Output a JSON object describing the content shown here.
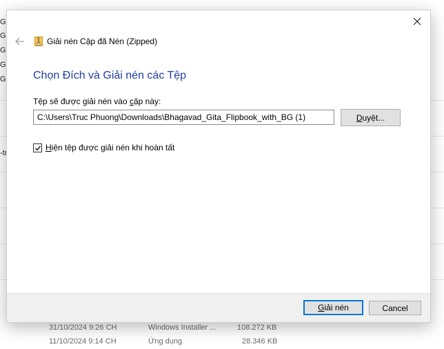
{
  "background": {
    "left_fragments": [
      "G",
      "G",
      "G",
      "G",
      "G",
      "-tr"
    ],
    "rows": [
      {
        "date": "31/10/2024 9:26 CH",
        "type": "Windows Installer ...",
        "size": "108.272 KB"
      },
      {
        "date": "11/10/2024 9:14 CH",
        "type": "Ứng dụng",
        "size": "28.346 KB"
      }
    ]
  },
  "dialog": {
    "title": "Giải nén Cặp đã Nén (Zipped)",
    "heading": "Chọn Đích và Giải nén các Tệp",
    "path_label": "Tệp sẽ được giải nén vào cặp này:",
    "path_value": "C:\\Users\\Truc Phuong\\Downloads\\Bhagavad_Gita_Flipbook_with_BG (1)",
    "browse_label": "Duyệt...",
    "show_files_label": "Hiện tệp được giải nén khi hoàn tất",
    "show_files_checked": true,
    "extract_label": "Giải nén",
    "cancel_label": "Cancel"
  },
  "colors": {
    "heading": "#1e3f9e",
    "focus_border": "#0078d7",
    "footer_bg": "#f0f0f0"
  },
  "icons": {
    "close": "close-icon",
    "back": "back-arrow-icon",
    "zip_folder": "zip-folder-icon",
    "check": "check-icon"
  }
}
